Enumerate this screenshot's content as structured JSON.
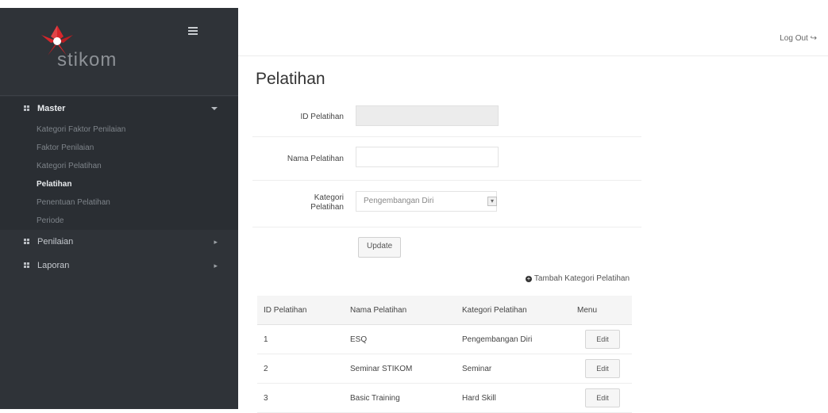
{
  "sidebar": {
    "logo_text": "stikom",
    "menu": [
      {
        "label": "Master",
        "expanded": true,
        "items": [
          {
            "label": "Kategori Faktor Penilaian",
            "active": false
          },
          {
            "label": "Faktor Penilaian",
            "active": false
          },
          {
            "label": "Kategori Pelatihan",
            "active": false
          },
          {
            "label": "Pelatihan",
            "active": true
          },
          {
            "label": "Penentuan Pelatihan",
            "active": false
          },
          {
            "label": "Periode",
            "active": false
          }
        ]
      },
      {
        "label": "Penilaian",
        "expanded": false
      },
      {
        "label": "Laporan",
        "expanded": false
      }
    ]
  },
  "header": {
    "logout_label": "Log Out"
  },
  "page": {
    "title": "Pelatihan"
  },
  "form": {
    "id_label": "ID Pelatihan",
    "id_value": "",
    "name_label": "Nama Pelatihan",
    "name_value": "",
    "category_label": "Kategori Pelatihan",
    "category_selected": "Pengembangan Diri",
    "update_label": "Update"
  },
  "add_link": "Tambah Kategori Pelatihan",
  "table": {
    "headers": [
      "ID Pelatihan",
      "Nama Pelatihan",
      "Kategori Pelatihan",
      "Menu"
    ],
    "rows": [
      {
        "id": "1",
        "name": "ESQ",
        "category": "Pengembangan Diri",
        "action": "Edit"
      },
      {
        "id": "2",
        "name": "Seminar STIKOM",
        "category": "Seminar",
        "action": "Edit"
      },
      {
        "id": "3",
        "name": "Basic Training",
        "category": "Hard Skill",
        "action": "Edit"
      }
    ]
  },
  "colors": {
    "sidebar_bg": "#2f3338",
    "logo_red": "#d7262b",
    "active_text": "#e9ecef"
  },
  "icons": [
    "stikom-logo-icon",
    "hamburger-icon",
    "grid-icon",
    "chevron-down-icon",
    "chevron-right-icon",
    "logout-icon",
    "plus-circle-icon",
    "dropdown-arrow-icon"
  ]
}
